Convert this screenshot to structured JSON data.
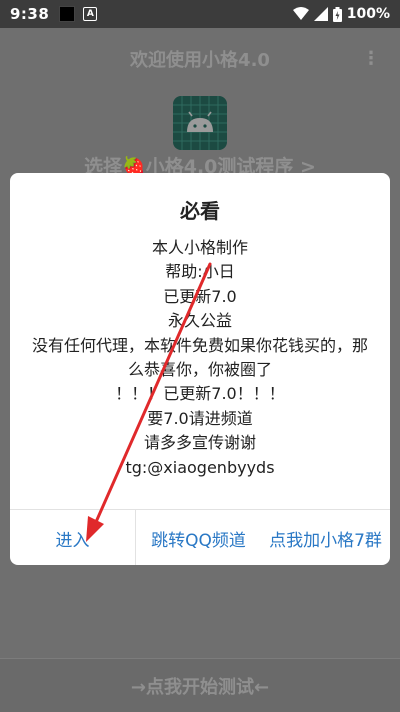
{
  "status_bar": {
    "time": "9:38",
    "battery": "100%",
    "icons": [
      "notification-black-icon",
      "notification-a-icon",
      "wifi-icon",
      "signal-icon",
      "battery-icon"
    ]
  },
  "app": {
    "title": "欢迎使用小格4.0",
    "subtitle": "选择🍓小格4.0测试程序 >",
    "start_button": "→点我开始测试←",
    "logo_icon": "android-icon"
  },
  "dialog": {
    "title": "必看",
    "lines": [
      "本人小格制作",
      "帮助:小日",
      "已更新7.0",
      "永久公益",
      "没有任何代理，本软件免费如果你花钱买的，那么恭喜你，你被圈了",
      "！！！已更新7.0！！！",
      "要7.0请进频道",
      "请多多宣传谢谢",
      "tg:@xiaogenbyyds"
    ],
    "buttons": {
      "enter": "进入",
      "qq_channel": "跳转QQ频道",
      "add": "点我加小格7群"
    }
  },
  "colors": {
    "accent": "#2a78c5",
    "annotation_arrow": "#e0292b",
    "scrim": "#6f6f6f"
  }
}
